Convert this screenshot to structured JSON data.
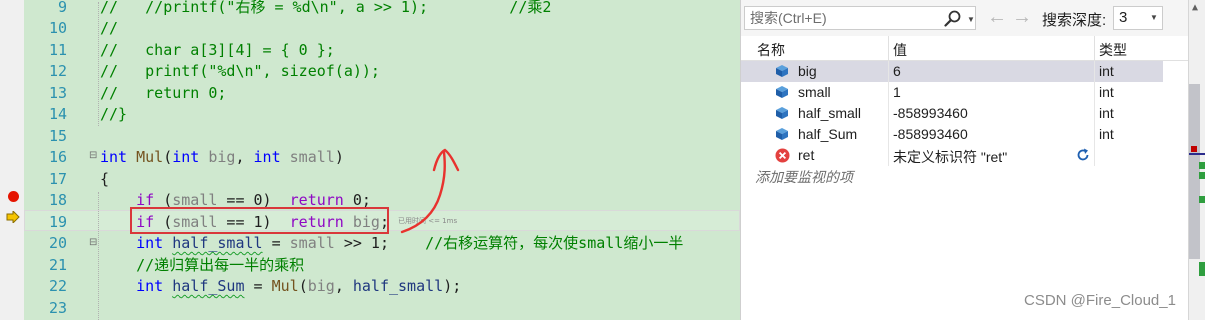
{
  "editor": {
    "lines": [
      {
        "n": "9",
        "segs": [
          {
            "t": "//   //printf(\"右移 = %d\\n\", a >> 1);         //乘2",
            "c": "cm"
          }
        ]
      },
      {
        "n": "10",
        "segs": [
          {
            "t": "//",
            "c": "cm"
          }
        ]
      },
      {
        "n": "11",
        "segs": [
          {
            "t": "//   char a[3][4] = { 0 };",
            "c": "cm"
          }
        ]
      },
      {
        "n": "12",
        "segs": [
          {
            "t": "//   printf(\"%d\\n\", sizeof(a));",
            "c": "cm"
          }
        ]
      },
      {
        "n": "13",
        "segs": [
          {
            "t": "//   return 0;",
            "c": "cm"
          }
        ]
      },
      {
        "n": "14",
        "segs": [
          {
            "t": "//}",
            "c": "cm"
          }
        ]
      },
      {
        "n": "15",
        "segs": []
      },
      {
        "n": "16",
        "segs": [
          {
            "t": "int",
            "c": "kw"
          },
          {
            "t": " ",
            "c": ""
          },
          {
            "t": "Mul",
            "c": "fn"
          },
          {
            "t": "(",
            "c": ""
          },
          {
            "t": "int",
            "c": "kw"
          },
          {
            "t": " ",
            "c": ""
          },
          {
            "t": "big",
            "c": "pm"
          },
          {
            "t": ", ",
            "c": ""
          },
          {
            "t": "int",
            "c": "kw"
          },
          {
            "t": " ",
            "c": ""
          },
          {
            "t": "small",
            "c": "pm"
          },
          {
            "t": ")",
            "c": ""
          }
        ]
      },
      {
        "n": "17",
        "segs": [
          {
            "t": "{",
            "c": ""
          }
        ]
      },
      {
        "n": "18",
        "segs": [
          {
            "t": "    ",
            "c": ""
          },
          {
            "t": "if",
            "c": "ctl"
          },
          {
            "t": " (",
            "c": ""
          },
          {
            "t": "small",
            "c": "pm"
          },
          {
            "t": " == 0)  ",
            "c": ""
          },
          {
            "t": "return",
            "c": "ctl"
          },
          {
            "t": " 0;",
            "c": ""
          }
        ]
      },
      {
        "n": "19",
        "segs": [
          {
            "t": "    ",
            "c": ""
          },
          {
            "t": "if",
            "c": "ctl"
          },
          {
            "t": " (",
            "c": ""
          },
          {
            "t": "small",
            "c": "pm"
          },
          {
            "t": " == 1)  ",
            "c": ""
          },
          {
            "t": "return",
            "c": "ctl"
          },
          {
            "t": " ",
            "c": ""
          },
          {
            "t": "big",
            "c": "pm"
          },
          {
            "t": ";",
            "c": ""
          }
        ]
      },
      {
        "n": "20",
        "segs": [
          {
            "t": "    ",
            "c": ""
          },
          {
            "t": "int",
            "c": "kw"
          },
          {
            "t": " ",
            "c": ""
          },
          {
            "t": "half_small",
            "c": "lv sq"
          },
          {
            "t": " = ",
            "c": ""
          },
          {
            "t": "small",
            "c": "pm"
          },
          {
            "t": " >> 1;    ",
            "c": ""
          },
          {
            "t": "//右移运算符，每次使small缩小一半",
            "c": "cm"
          }
        ]
      },
      {
        "n": "21",
        "segs": [
          {
            "t": "    ",
            "c": ""
          },
          {
            "t": "//递归算出每一半的乘积",
            "c": "cm"
          }
        ]
      },
      {
        "n": "22",
        "segs": [
          {
            "t": "    ",
            "c": ""
          },
          {
            "t": "int",
            "c": "kw"
          },
          {
            "t": " ",
            "c": ""
          },
          {
            "t": "half_Sum",
            "c": "lv sq"
          },
          {
            "t": " = ",
            "c": ""
          },
          {
            "t": "Mul",
            "c": "fn"
          },
          {
            "t": "(",
            "c": ""
          },
          {
            "t": "big",
            "c": "pm"
          },
          {
            "t": ", ",
            "c": ""
          },
          {
            "t": "half_small",
            "c": "lv"
          },
          {
            "t": ");",
            "c": ""
          }
        ]
      },
      {
        "n": "23",
        "segs": []
      }
    ],
    "elapsed_label": "已用时间 <= 1ms"
  },
  "watch": {
    "search_placeholder": "搜索(Ctrl+E)",
    "depth_label": "搜索深度:",
    "depth_value": "3",
    "columns": {
      "name": "名称",
      "value": "值",
      "type": "类型"
    },
    "rows": [
      {
        "name": "big",
        "value": "6",
        "type": "int",
        "icon": "variable-icon",
        "selected": true
      },
      {
        "name": "small",
        "value": "1",
        "type": "int",
        "icon": "variable-icon"
      },
      {
        "name": "half_small",
        "value": "-858993460",
        "type": "int",
        "icon": "variable-icon"
      },
      {
        "name": "half_Sum",
        "value": "-858993460",
        "type": "int",
        "icon": "variable-icon"
      },
      {
        "name": "ret",
        "value": "未定义标识符 \"ret\"",
        "type": "",
        "icon": "error-icon",
        "refresh": true
      }
    ],
    "add_item_label": "添加要监视的项"
  },
  "watermark": "CSDN @Fire_Cloud_1",
  "colors": {
    "code_background": "#cfe8cf",
    "breakpoint": "#e51400",
    "annotation_red": "#d9373b"
  }
}
